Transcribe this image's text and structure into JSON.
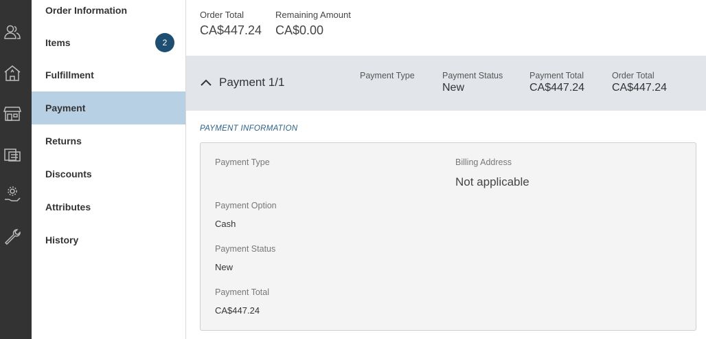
{
  "rail": {
    "icons": [
      "users-icon",
      "store-building-icon",
      "storefront-icon",
      "register-icon",
      "settings-hand-icon",
      "wrench-icon"
    ]
  },
  "sidebar": {
    "items": [
      {
        "label": "Order Information"
      },
      {
        "label": "Items",
        "badge": "2"
      },
      {
        "label": "Fulfillment"
      },
      {
        "label": "Payment",
        "active": true
      },
      {
        "label": "Returns"
      },
      {
        "label": "Discounts"
      },
      {
        "label": "Attributes"
      },
      {
        "label": "History"
      }
    ]
  },
  "summary": {
    "order_total_label": "Order Total",
    "order_total_value": "CA$447.24",
    "remaining_label": "Remaining Amount",
    "remaining_value": "CA$0.00"
  },
  "payment_band": {
    "title": "Payment 1/1",
    "type_label": "Payment Type",
    "type_value": "",
    "status_label": "Payment Status",
    "status_value": "New",
    "total_label": "Payment Total",
    "total_value": "CA$447.24",
    "order_total_label": "Order Total",
    "order_total_value": "CA$447.24"
  },
  "payment_info": {
    "section_title": "PAYMENT INFORMATION",
    "type_label": "Payment Type",
    "type_value": "",
    "option_label": "Payment Option",
    "option_value": "Cash",
    "status_label": "Payment Status",
    "status_value": "New",
    "total_label": "Payment Total",
    "total_value": "CA$447.24",
    "billing_label": "Billing Address",
    "billing_value": "Not applicable"
  },
  "colors": {
    "rail_bg": "#333333",
    "active_nav": "#b8d0e4",
    "badge": "#1e4f73",
    "band_bg": "#e2e6ea",
    "section_title": "#2b5f86"
  }
}
